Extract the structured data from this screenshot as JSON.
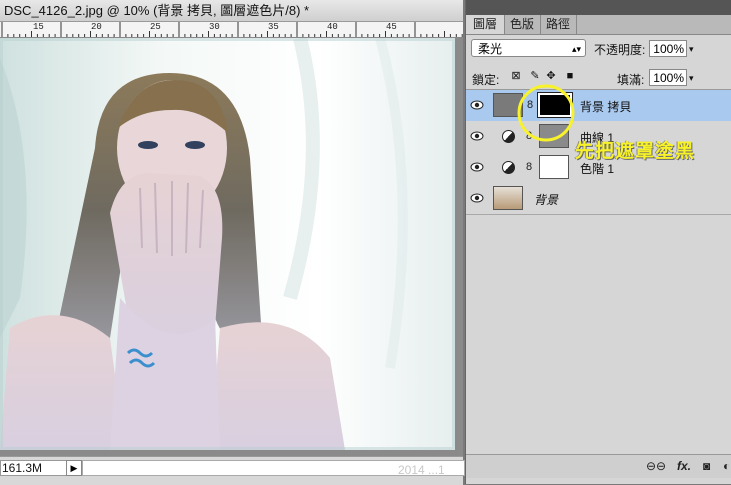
{
  "document": {
    "title": "DSC_4126_2.jpg @ 10% (背景 拷貝, 圖層遮色片/8) *",
    "ruler_ticks": [
      "15",
      "20",
      "25",
      "30",
      "35",
      "40",
      "45"
    ],
    "status_size": "161.3M",
    "watermark": "2014 ...1"
  },
  "panel": {
    "tabs": [
      "圖層",
      "色版",
      "路徑"
    ],
    "active_tab": 0,
    "blend_mode": "柔光",
    "opacity_label": "不透明度:",
    "opacity_value": "100%",
    "lock_label": "鎖定:",
    "fill_label": "填滿:",
    "fill_value": "100%",
    "layers": [
      {
        "name": "背景 拷貝",
        "visible": true,
        "selected": true,
        "has_mask": true
      },
      {
        "name": "曲線 1",
        "visible": true,
        "selected": false,
        "adjustment": true
      },
      {
        "name": "色階 1",
        "visible": true,
        "selected": false,
        "adjustment": true
      },
      {
        "name": "背景",
        "visible": true,
        "selected": false,
        "italic": true
      }
    ],
    "callout_text": "先把遮罩塗黑",
    "footer_icons": [
      "link-icon",
      "fx-icon",
      "mask-icon"
    ]
  },
  "colors": {
    "selection": "#a9c9ef",
    "annotation": "#f7f22a",
    "panel_bg": "#d6d6d6"
  }
}
